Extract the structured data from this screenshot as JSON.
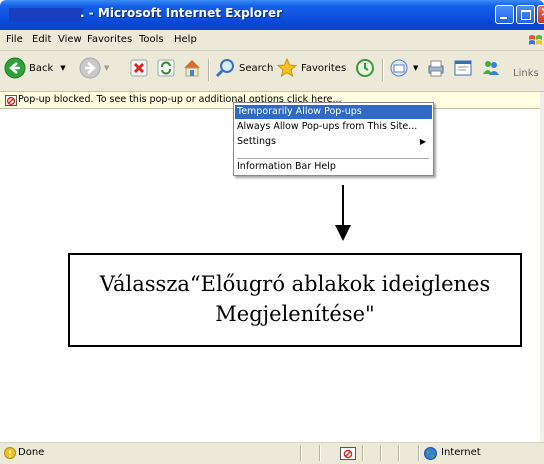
{
  "window": {
    "title": ". - Microsoft Internet Explorer"
  },
  "menu": [
    "File",
    "Edit",
    "View",
    "Favorites",
    "Tools",
    "Help"
  ],
  "toolbar": {
    "back": "Back",
    "search": "Search",
    "favorites": "Favorites",
    "links": "Links"
  },
  "infobar": {
    "text": "Pop-up blocked. To see this pop-up or additional options click here..."
  },
  "context_menu": {
    "items": [
      {
        "label": "Temporarily Allow Pop-ups",
        "selected": true
      },
      {
        "label": "Always Allow Pop-ups from This Site...",
        "selected": false
      },
      {
        "label": "Settings",
        "submenu": true
      },
      {
        "label": "Information Bar Help",
        "selected": false
      }
    ]
  },
  "annotation": {
    "line1": "Válassza“Előugró ablakok ideiglenes",
    "line2": "Megjelenítése\""
  },
  "statusbar": {
    "status": "Done",
    "zone": "Internet"
  },
  "colors": {
    "title_bar": "#0a4ad8",
    "menu_highlight": "#316ac5",
    "info_bar": "#fffee1",
    "chrome": "#ece9d8"
  }
}
